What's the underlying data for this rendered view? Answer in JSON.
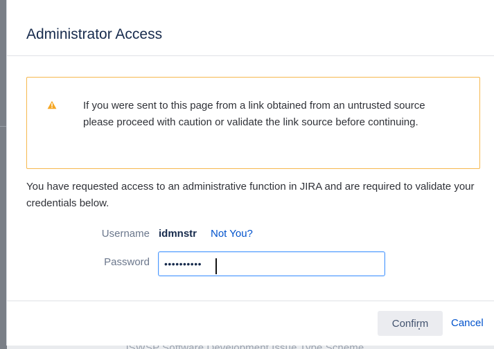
{
  "dialog": {
    "title": "Administrator Access"
  },
  "warning": {
    "icon": "warning-icon",
    "icon_color": "#f5a623",
    "border_color": "#f6b84d",
    "message": "If you were sent to this page from a link obtained from an untrusted source please proceed with caution or validate the link source before continuing."
  },
  "intro": {
    "text": "You have requested access to an administrative function in JIRA and are required to validate your credentials below."
  },
  "username": {
    "label": "Username",
    "value": "idmnstr",
    "not_you_label": "Not You?"
  },
  "password": {
    "label": "Password",
    "value": "••••••••••"
  },
  "footer": {
    "confirm_label": "Confirm",
    "cancel_label": "Cancel"
  },
  "background": {
    "partial_text": "JSWSP Software Development Issue Type Scheme"
  },
  "colors": {
    "link": "#0052cc",
    "input_focus": "#4c9aff",
    "button_background": "#ebecf0"
  }
}
